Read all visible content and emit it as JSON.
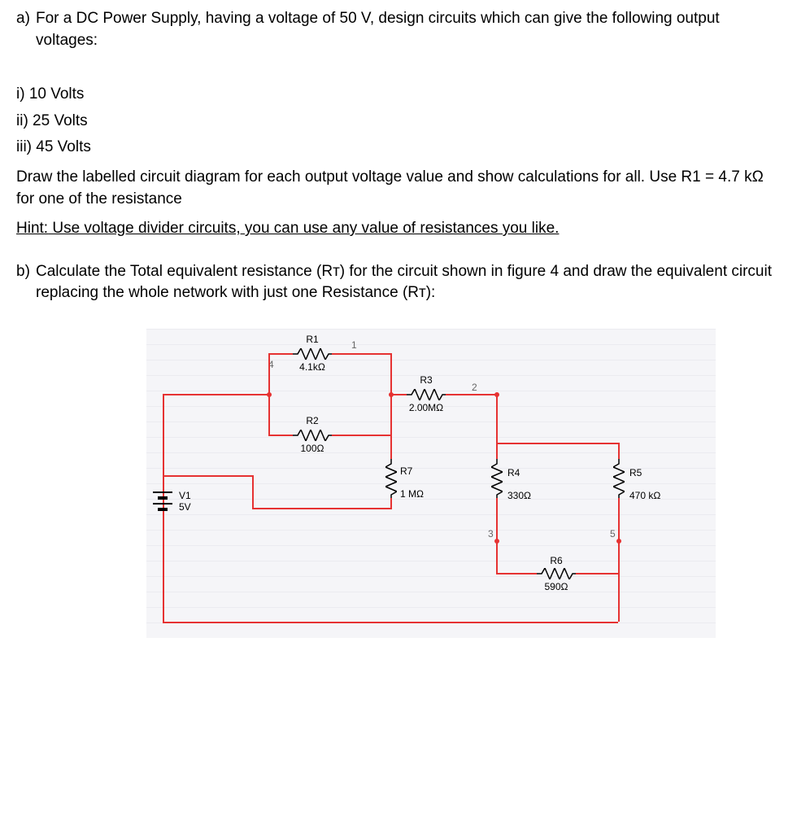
{
  "partA": {
    "intro_label": "a)",
    "intro_text": "For a DC Power Supply, having a voltage of 50 V, design circuits which can give the following output voltages:",
    "items": [
      "i) 10 Volts",
      "ii) 25 Volts",
      "iii) 45 Volts"
    ],
    "instr": "Draw the labelled circuit diagram for each output voltage value and show calculations for all. Use R1 = 4.7 kΩ for one of the resistance",
    "hint_label": "Hint:",
    "hint_text": " Use voltage divider circuits, you can use any value of resistances you like."
  },
  "partB": {
    "intro_label": "b)",
    "intro_text": "Calculate the Total equivalent resistance (Rᴛ) for the circuit shown in figure 4 and draw the equivalent circuit replacing the whole network with just one Resistance (Rᴛ):"
  },
  "circuit": {
    "source": {
      "name": "V1",
      "value": "5V"
    },
    "nodes": {
      "n1": "1",
      "n2": "2",
      "n3": "3",
      "n4": "4",
      "n5": "5"
    },
    "components": {
      "R1": {
        "name": "R1",
        "value": "4.1kΩ"
      },
      "R2": {
        "name": "R2",
        "value": "100Ω"
      },
      "R3": {
        "name": "R3",
        "value": "2.00MΩ"
      },
      "R4": {
        "name": "R4",
        "value": "330Ω"
      },
      "R5": {
        "name": "R5",
        "value": "470 kΩ"
      },
      "R6": {
        "name": "R6",
        "value": "590Ω"
      },
      "R7": {
        "name": "R7",
        "value": "1 MΩ"
      }
    }
  }
}
